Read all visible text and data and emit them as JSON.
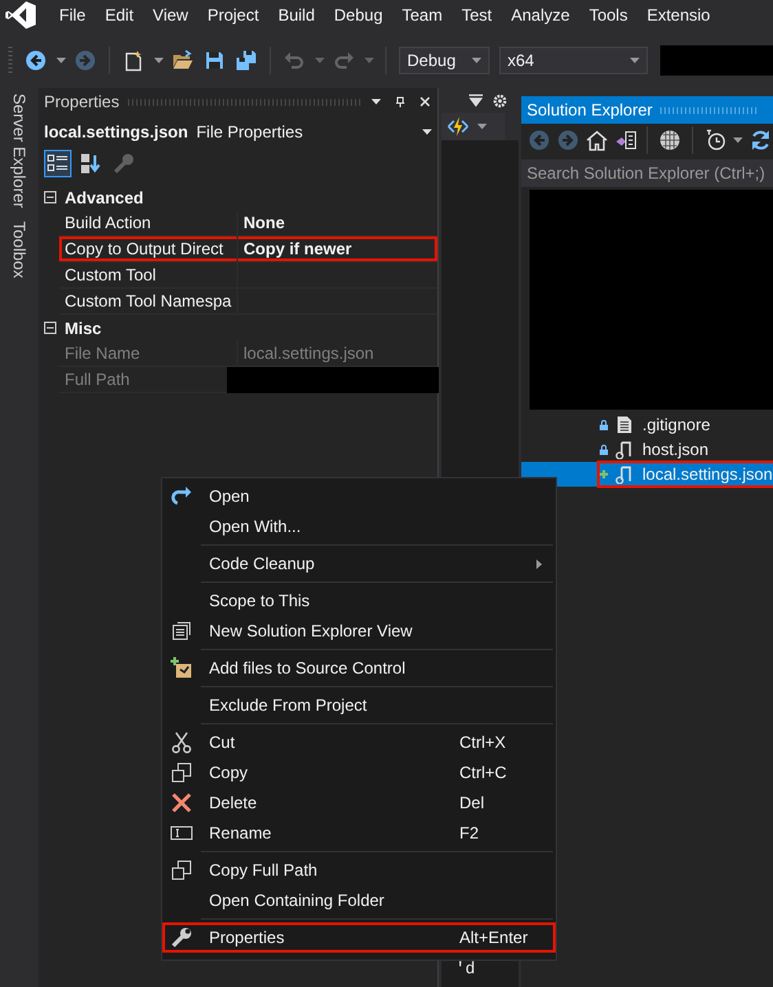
{
  "menu_bar": {
    "items": [
      "File",
      "Edit",
      "View",
      "Project",
      "Build",
      "Debug",
      "Team",
      "Test",
      "Analyze",
      "Tools",
      "Extensio"
    ]
  },
  "toolbar": {
    "groups": [
      [
        {
          "disabled": false
        },
        {
          "disabled": true
        }
      ],
      [
        {
          "disabled": false
        },
        {
          "disabled": false
        },
        {
          "disabled": false
        },
        {
          "disabled": false
        }
      ],
      [
        {
          "disabled": true
        },
        {
          "disabled": true
        }
      ]
    ],
    "configuration": "Debug",
    "platform": "x64"
  },
  "side_tabs": [
    "Server Explorer",
    "Toolbox"
  ],
  "properties": {
    "title": "Properties",
    "object_name": "local.settings.json",
    "object_type": "File Properties",
    "view_buttons": [
      {
        "selected": true,
        "disabled": false
      },
      {
        "selected": false,
        "disabled": false
      },
      {
        "selected": false,
        "disabled": true
      }
    ],
    "categories": [
      {
        "label": "Advanced",
        "expanded": true,
        "rows": [
          {
            "name": "Build Action",
            "value": "None",
            "modified": true,
            "readonly": false,
            "highlighted": false
          },
          {
            "name": "Copy to Output Direct",
            "value": "Copy if newer",
            "modified": true,
            "readonly": false,
            "highlighted": true
          },
          {
            "name": "Custom Tool",
            "readonly": false,
            "highlighted": false
          },
          {
            "name": "Custom Tool Namespa",
            "readonly": false,
            "highlighted": false
          }
        ]
      },
      {
        "label": "Misc",
        "expanded": true,
        "rows": [
          {
            "name": "File Name",
            "value": "local.settings.json",
            "modified": false,
            "readonly": true,
            "highlighted": false
          },
          {
            "name": "Full Path",
            "readonly": true,
            "highlighted": false,
            "redacted": true
          }
        ]
      }
    ]
  },
  "solution_explorer": {
    "title": "Solution Explorer",
    "search": {
      "placeholder": "Search Solution Explorer (Ctrl+;)"
    },
    "toolbar": [
      {
        "disabled": true
      },
      {
        "disabled": true
      },
      {
        "disabled": false
      },
      {
        "disabled": false
      },
      {
        "disabled": false
      },
      {
        "disabled": false
      },
      {
        "disabled": false
      }
    ],
    "items": [
      {
        "label": ".gitignore",
        "selected": false,
        "highlighted": false
      },
      {
        "label": "host.json",
        "selected": false,
        "highlighted": false
      },
      {
        "label": "local.settings.json",
        "selected": true,
        "highlighted": true
      }
    ]
  },
  "context_menu": {
    "groups": [
      [
        {
          "label": "Open",
          "submenu": false,
          "highlighted": false
        },
        {
          "label": "Open With...",
          "submenu": false,
          "highlighted": false
        }
      ],
      [
        {
          "label": "Code Cleanup",
          "submenu": true,
          "highlighted": false
        }
      ],
      [
        {
          "label": "Scope to This",
          "submenu": false,
          "highlighted": false
        },
        {
          "label": "New Solution Explorer View",
          "submenu": false,
          "highlighted": false
        }
      ],
      [
        {
          "label": "Add files to Source Control",
          "submenu": false,
          "highlighted": false
        }
      ],
      [
        {
          "label": "Exclude From Project",
          "submenu": false,
          "highlighted": false
        }
      ],
      [
        {
          "label": "Cut",
          "shortcut": "Ctrl+X",
          "submenu": false,
          "highlighted": false
        },
        {
          "label": "Copy",
          "shortcut": "Ctrl+C",
          "submenu": false,
          "highlighted": false
        },
        {
          "label": "Delete",
          "shortcut": "Del",
          "submenu": false,
          "highlighted": false
        },
        {
          "label": "Rename",
          "shortcut": "F2",
          "submenu": false,
          "highlighted": false
        }
      ],
      [
        {
          "label": "Copy Full Path",
          "submenu": false,
          "highlighted": false
        },
        {
          "label": "Open Containing Folder",
          "submenu": false,
          "highlighted": false
        }
      ],
      [
        {
          "label": "Properties",
          "shortcut": "Alt+Enter",
          "submenu": false,
          "highlighted": true
        }
      ]
    ]
  },
  "editor": {
    "code_fragment": "'d"
  }
}
